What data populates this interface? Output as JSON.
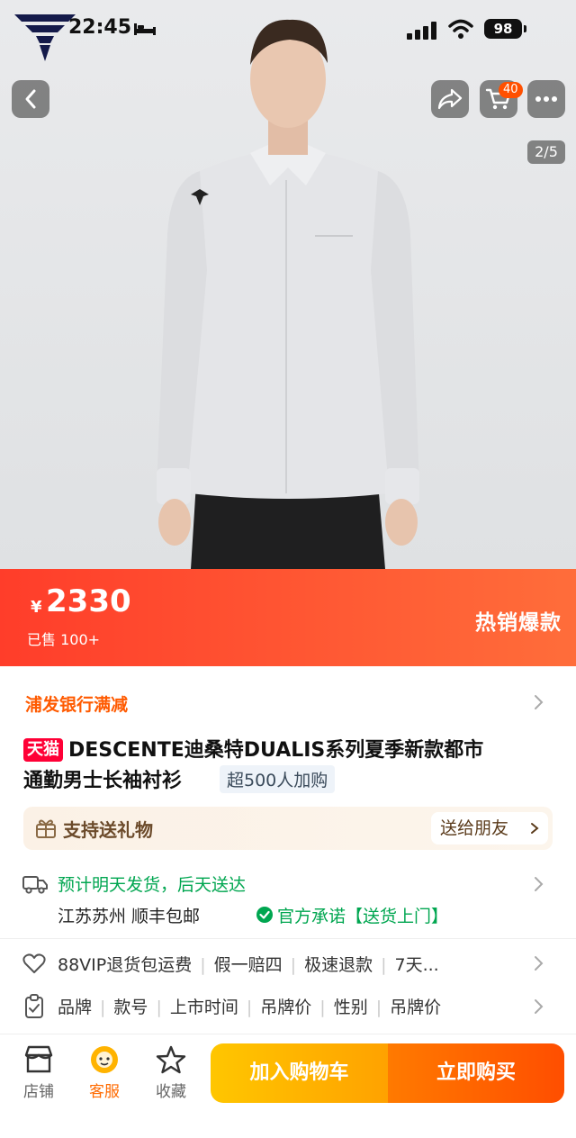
{
  "status_bar": {
    "time": "22:45",
    "battery": "98"
  },
  "header": {
    "page_indicator": "2/5",
    "cart_count": "40"
  },
  "price_banner": {
    "currency": "¥",
    "price": "2330",
    "sold": "已售 100+",
    "hot_label": "热销爆款"
  },
  "promo": {
    "label": "浦发银行满减"
  },
  "product": {
    "platform_badge": "天猫",
    "title_line1": "DESCENTE迪桑特DUALIS系列夏季新款都市",
    "title_line2": "通勤男士长袖衬衫",
    "add_count": "超500人加购"
  },
  "gift": {
    "label": "支持送礼物",
    "send_button": "送给朋友"
  },
  "shipping": {
    "estimate": "预计明天发货，后天送达",
    "origin": "江苏苏州  顺丰包邮",
    "official": "官方承诺【送货上门】"
  },
  "services": {
    "items": [
      "88VIP退货包运费",
      "假一赔四",
      "极速退款",
      "7天..."
    ]
  },
  "params": {
    "items": [
      "品牌",
      "款号",
      "上市时间",
      "吊牌价",
      "性别",
      "吊牌价"
    ]
  },
  "bottom_bar": {
    "store": "店铺",
    "service": "客服",
    "favorite": "收藏",
    "add_to_cart": "加入购物车",
    "buy_now": "立即购买"
  },
  "colors": {
    "accent": "#ff5000",
    "tmall": "#ff0036",
    "green": "#00a650",
    "cart_button": "#ffb300",
    "buy_button": "#ff5a00"
  },
  "icons": [
    "back-icon",
    "share-icon",
    "cart-icon",
    "more-icon",
    "gift-icon",
    "truck-icon",
    "check-icon",
    "heart-icon",
    "clipboard-icon",
    "store-icon",
    "service-icon",
    "star-icon"
  ]
}
